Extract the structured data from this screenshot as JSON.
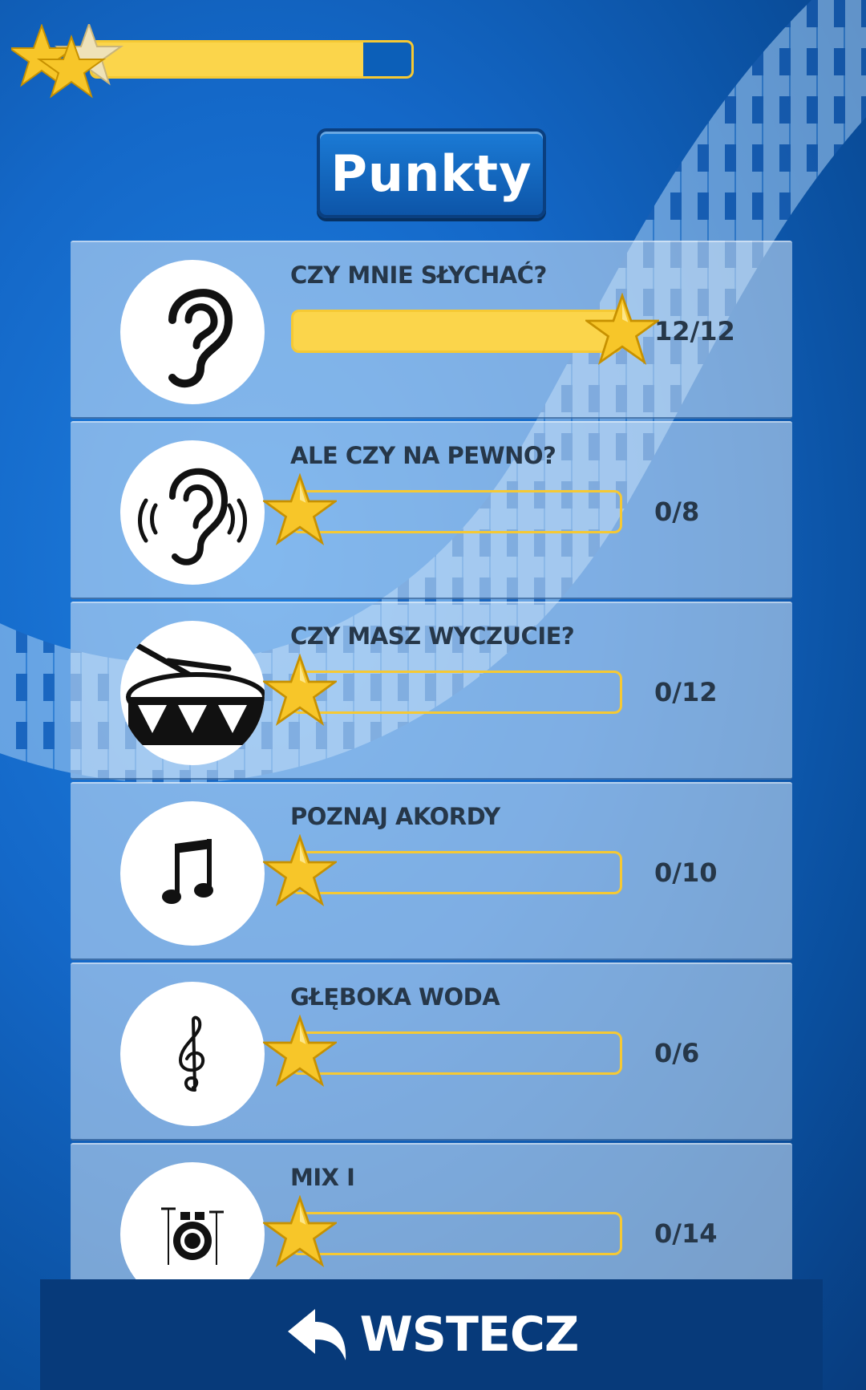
{
  "colors": {
    "accent": "#fbd54b",
    "background": "#1468c8",
    "text": "#263749"
  },
  "header": {
    "progress": 0.85,
    "stars": [
      "star-icon",
      "star-icon",
      "star-icon"
    ]
  },
  "title": "Punkty",
  "levels": [
    {
      "label": "CZY MNIE SŁYCHAĆ?",
      "score": "12/12",
      "progress": 1.0,
      "icon": "ear-icon"
    },
    {
      "label": "ALE CZY NA PEWNO?",
      "score": "0/8",
      "progress": 0.0,
      "icon": "listening-ear-icon"
    },
    {
      "label": "CZY MASZ WYCZUCIE?",
      "score": "0/12",
      "progress": 0.0,
      "icon": "drum-icon"
    },
    {
      "label": "POZNAJ AKORDY",
      "score": "0/10",
      "progress": 0.0,
      "icon": "music-notes-icon"
    },
    {
      "label": "GŁĘBOKA WODA",
      "score": "0/6",
      "progress": 0.0,
      "icon": "treble-clef-icon"
    },
    {
      "label": "MIX I",
      "score": "0/14",
      "progress": 0.0,
      "icon": "drum-kit-icon"
    }
  ],
  "back_button": {
    "label": "WSTECZ",
    "icon": "back-arrow-icon"
  }
}
